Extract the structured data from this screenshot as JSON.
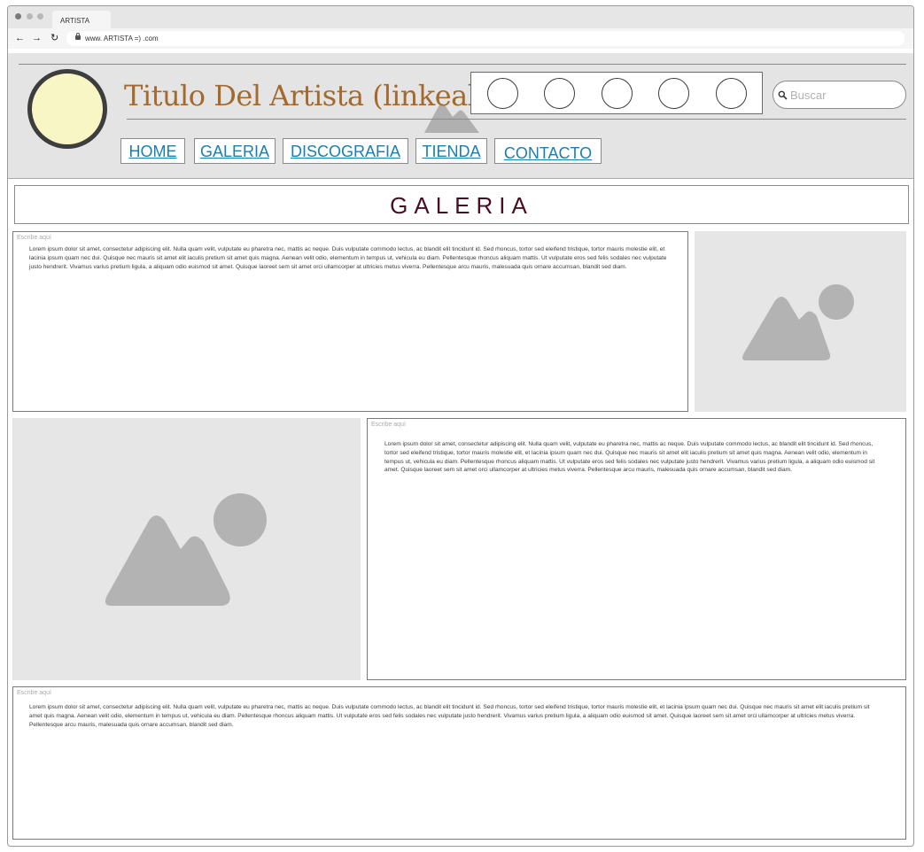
{
  "browser": {
    "tab_title": "ARTISTA",
    "url": "www. ARTISTA =) .com"
  },
  "header": {
    "site_title": "Titulo Del Artista (linkeable)",
    "search_placeholder": "Buscar",
    "nav": [
      {
        "label": "HOME"
      },
      {
        "label": "GALERIA"
      },
      {
        "label": "DISCOGRAFIA"
      },
      {
        "label": "TIENDA"
      },
      {
        "label": "CONTACTO"
      }
    ]
  },
  "page": {
    "section_title": "GALERIA",
    "blocks": [
      {
        "hint": "Escribe aquí",
        "text": "Lorem ipsum dolor sit amet, consectetur adipiscing elit. Nulla quam velit, vulputate eu pharetra nec, mattis ac neque. Duis vulputate commodo lectus, ac blandit elit tincidunt id. Sed rhoncus, tortor sed eleifend tristique, tortor mauris molestie elit, et lacinia ipsum quam nec dui. Quisque nec mauris sit amet elit iaculis pretium sit amet quis magna. Aenean velit odio, elementum in tempus ut, vehicula eu diam. Pellentesque rhoncus aliquam mattis. Ut vulputate eros sed felis sodales nec vulputate justo hendrerit. Vivamus varius pretium ligula, a aliquam odio euismod sit amet. Quisque laoreet sem sit amet orci ullamcorper at ultricies metus viverra. Pellentesque arcu mauris, malesuada quis ornare accumsan, blandit sed diam."
      },
      {
        "hint": "Escribe aquí",
        "text": "Lorem ipsum dolor sit amet, consectetur adipiscing elit. Nulla quam velit, vulputate eu pharetra nec, mattis ac neque. Duis vulputate commodo lectus, ac blandit elit tincidunt id. Sed rhoncus, tortor sed eleifend tristique, tortor mauris molestie elit, et lacinia ipsum quam nec dui. Quisque nec mauris sit amet elit iaculis pretium sit amet quis magna. Aenean velit odio, elementum in tempus ut, vehicula eu diam. Pellentesque rhoncus aliquam mattis. Ut vulputate eros sed felis sodales nec vulputate justo hendrerit. Vivamus varius pretium ligula, a aliquam odio euismod sit amet. Quisque laoreet sem sit amet orci ullamcorper at ultricies metus viverra. Pellentesque arcu mauris, malesuada quis ornare accumsan, blandit sed diam."
      },
      {
        "hint": "Escribe aquí",
        "text": "Lorem ipsum dolor sit amet, consectetur adipiscing elit. Nulla quam velit, vulputate eu pharetra nec, mattis ac neque. Duis vulputate commodo lectus, ac blandit elit tincidunt id. Sed rhoncus, tortor sed eleifend tristique, tortor mauris molestie elit, et lacinia ipsum quam nec dui. Quisque nec mauris sit amet elit iaculis pretium sit amet quis magna. Aenean velit odio, elementum in tempus ut, vehicula eu diam. Pellentesque rhoncus aliquam mattis. Ut vulputate eros sed felis sodales nec vulputate justo hendrerit. Vivamus varius pretium ligula, a aliquam odio euismod sit amet. Quisque laoreet sem sit amet orci ullamcorper at ultricies metus viverra. Pellentesque arcu mauris, malesuada quis ornare accumsan, blandit sed diam."
      }
    ]
  },
  "icons": {
    "back": "back-arrow-icon",
    "forward": "forward-arrow-icon",
    "reload": "reload-icon",
    "lock": "lock-icon",
    "search": "search-icon",
    "image": "image-placeholder-icon"
  },
  "colors": {
    "title": "#a4692d",
    "nav_link": "#1a7fb0",
    "section_title": "#4a0e22",
    "logo_fill": "#f8f6c4"
  }
}
